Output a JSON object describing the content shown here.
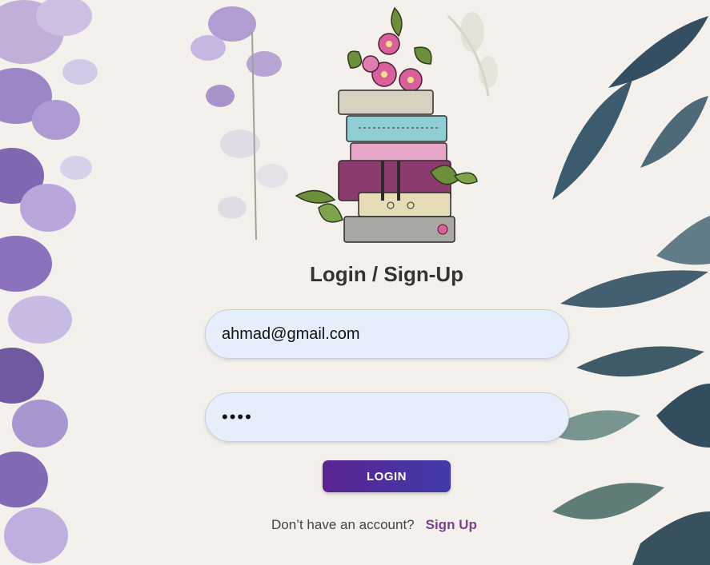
{
  "page": {
    "title": "Login / Sign-Up"
  },
  "form": {
    "email_value": "ahmad@gmail.com",
    "password_value": "••••",
    "login_label": "LOGIN"
  },
  "footer": {
    "prompt": "Don’t have an account?",
    "signup_label": "Sign Up"
  },
  "icons": {
    "logo": "book-stack-flower-icon"
  },
  "colors": {
    "button_start": "#5b2392",
    "button_end": "#3f3ca8",
    "field_bg": "#e7eefb",
    "link": "#7c3f8f",
    "page_bg": "#f4f1ec"
  }
}
